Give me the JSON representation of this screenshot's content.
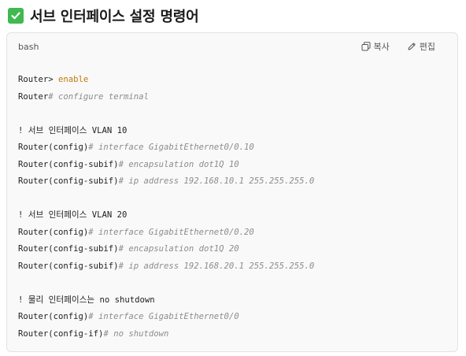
{
  "heading": {
    "icon": "check-mark-icon",
    "icon_color": "#3fb950",
    "text": "서브 인터페이스 설정 명령어"
  },
  "code_block": {
    "language": "bash",
    "copy_label": "복사",
    "edit_label": "편집",
    "colors": {
      "prompt": "#1f1f1f",
      "keyword": "#c27a10",
      "command": "#8c8c8c"
    },
    "lines": [
      {
        "prompt": "Router>",
        "sep": " ",
        "keyword": "enable",
        "cmd": ""
      },
      {
        "prompt": "Router",
        "sep": "",
        "keyword": "",
        "cmd": "# configure terminal"
      },
      {
        "blank": true
      },
      {
        "comment": "! 서브 인터페이스 VLAN 10"
      },
      {
        "prompt": "Router(config)",
        "sep": "",
        "keyword": "",
        "cmd": "# interface GigabitEthernet0/0.10"
      },
      {
        "prompt": "Router(config-subif)",
        "sep": "",
        "keyword": "",
        "cmd": "# encapsulation dot1Q 10"
      },
      {
        "prompt": "Router(config-subif)",
        "sep": "",
        "keyword": "",
        "cmd": "# ip address 192.168.10.1 255.255.255.0"
      },
      {
        "blank": true
      },
      {
        "comment": "! 서브 인터페이스 VLAN 20"
      },
      {
        "prompt": "Router(config)",
        "sep": "",
        "keyword": "",
        "cmd": "# interface GigabitEthernet0/0.20"
      },
      {
        "prompt": "Router(config-subif)",
        "sep": "",
        "keyword": "",
        "cmd": "# encapsulation dot1Q 20"
      },
      {
        "prompt": "Router(config-subif)",
        "sep": "",
        "keyword": "",
        "cmd": "# ip address 192.168.20.1 255.255.255.0"
      },
      {
        "blank": true
      },
      {
        "comment": "! 물리 인터페이스는 no shutdown"
      },
      {
        "prompt": "Router(config)",
        "sep": "",
        "keyword": "",
        "cmd": "# interface GigabitEthernet0/0"
      },
      {
        "prompt": "Router(config-if)",
        "sep": "",
        "keyword": "",
        "cmd": "# no shutdown"
      }
    ]
  }
}
